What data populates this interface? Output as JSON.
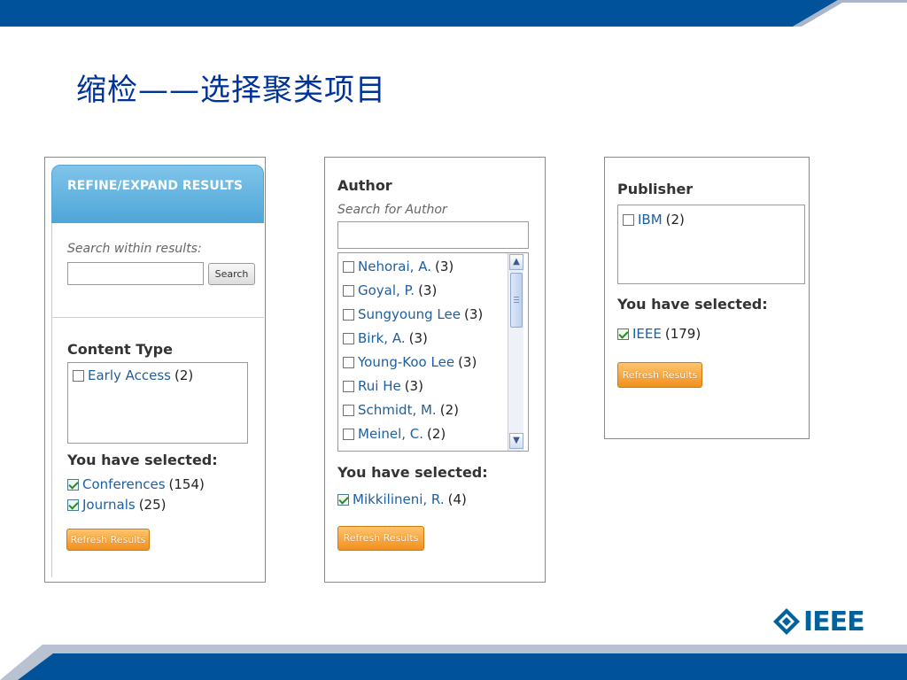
{
  "slide": {
    "title": "缩检——选择聚类项目",
    "colors": {
      "band": "#00529b",
      "band_light": "#aab6c8",
      "title": "#003399",
      "link": "#1f5fa0",
      "refresh": "#f0901e"
    }
  },
  "refine_panel": {
    "header": "REFINE/EXPAND RESULTS",
    "search_label": "Search within results:",
    "search_value": "",
    "search_button": "Search",
    "content_type_heading": "Content Type",
    "content_type_options": [
      {
        "label": "Early Access",
        "count": "(2)",
        "checked": false
      }
    ],
    "selected_heading": "You have selected:",
    "selected": [
      {
        "label": "Conferences",
        "count": "(154)",
        "checked": true
      },
      {
        "label": "Journals",
        "count": "(25)",
        "checked": true
      }
    ],
    "refresh_button": "Refresh Results"
  },
  "author_panel": {
    "heading": "Author",
    "search_label": "Search for Author",
    "search_value": "",
    "options": [
      {
        "label": "Nehorai, A.",
        "count": "(3)",
        "checked": false
      },
      {
        "label": "Goyal, P.",
        "count": "(3)",
        "checked": false
      },
      {
        "label": "Sungyoung Lee",
        "count": "(3)",
        "checked": false
      },
      {
        "label": "Birk, A.",
        "count": "(3)",
        "checked": false
      },
      {
        "label": "Young-Koo Lee",
        "count": "(3)",
        "checked": false
      },
      {
        "label": "Rui He",
        "count": "(3)",
        "checked": false
      },
      {
        "label": "Schmidt, M.",
        "count": "(2)",
        "checked": false
      },
      {
        "label": "Meinel, C.",
        "count": "(2)",
        "checked": false
      }
    ],
    "selected_heading": "You have selected:",
    "selected": [
      {
        "label": "Mikkilineni, R.",
        "count": "(4)",
        "checked": true
      }
    ],
    "refresh_button": "Refresh Results",
    "scroll_up": "▲",
    "scroll_down": "▼"
  },
  "publisher_panel": {
    "heading": "Publisher",
    "options": [
      {
        "label": "IBM",
        "count": "(2)",
        "checked": false
      }
    ],
    "selected_heading": "You have selected:",
    "selected": [
      {
        "label": "IEEE",
        "count": "(179)",
        "checked": true
      }
    ],
    "refresh_button": "Refresh Results"
  },
  "logo": {
    "text": "IEEE",
    "icon": "ieee-diamond-icon"
  }
}
